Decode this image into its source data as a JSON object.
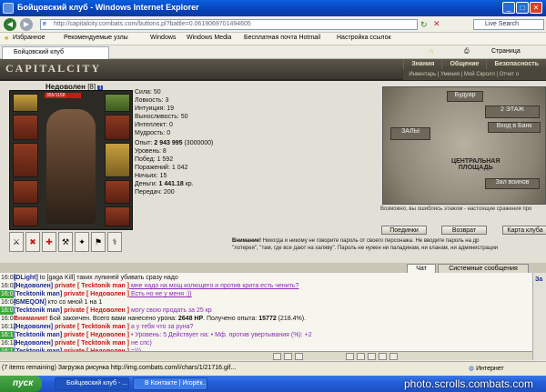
{
  "window": {
    "title": "Бойцовский клуб - Windows Internet Explorer",
    "address": "http://capitalcity.combats.com/buttons.pl?battle=0.0619069701494605",
    "search_placeholder": "Live Search"
  },
  "favorites": {
    "items": [
      "Избранное",
      "Рекомендуемые узлы",
      "Windows",
      "Windows Media",
      "Бесплатная почта Hotmail",
      "Настройка ссылок"
    ],
    "page_menu": "Страница"
  },
  "tab": {
    "label": "Бойцовский клуб"
  },
  "game": {
    "logo": "CAPITALCITY",
    "menu": [
      "Знания",
      "Общение",
      "Безопасность"
    ],
    "submenu": "Инвентарь | Умения | Мой Скролл | Отчет о",
    "character": {
      "name": "Недоволен",
      "level": "[8]",
      "badge": "i",
      "hp": "355/1158"
    },
    "stats_primary": [
      "Сила: 50",
      "Ловкость: 3",
      "Интуиция: 19",
      "Выносливость: 50",
      "Интеллект: 0",
      "Мудрость: 0"
    ],
    "stats_secondary": [
      {
        "label": "Опыт: ",
        "value": "2 943 995",
        "extra": " (3000000)"
      },
      {
        "label": "Уровень: ",
        "value": "8",
        "extra": ""
      },
      {
        "label": "Побед: ",
        "value": "1 592",
        "extra": ""
      },
      {
        "label": "Поражений: ",
        "value": "1 042",
        "extra": ""
      },
      {
        "label": "Ничьих: ",
        "value": "15",
        "extra": ""
      },
      {
        "label": "Деньги: ",
        "value": "1 441.18",
        "extra": " кр."
      },
      {
        "label": "Передач: ",
        "value": "200",
        "extra": ""
      }
    ],
    "map": {
      "buildings": [
        "Будуар",
        "2 ЭТАЖ",
        "Вход в Банк",
        "ЗАЛЫ",
        "Зал воинов"
      ],
      "center": "ЦЕНТРАЛЬНАЯ\nПЛОЩАДЬ",
      "hint": "Возможно, вы ошиблись этажом - настоящие сражения про"
    },
    "buttons": [
      "Поединки",
      "Возврат",
      "Карта клуба"
    ],
    "warning_title": "Внимание!",
    "warning_line1": " Никогда и никому не говорите пароль от своего персонажа. Не вводите пароль на др",
    "warning_line2": "\"лотерея\", \"там, где все дают на халяву\". Пароль не нужен ни паладинам, ни кланам, ни администрации"
  },
  "chat": {
    "tabs": [
      "Чат",
      "Системные сообщения"
    ],
    "rows": [
      {
        "time": "16:01",
        "hl": false,
        "parts": [
          {
            "c": "nick",
            "t": "[DLight]"
          },
          {
            "c": "sys",
            "t": " to [gaga Kill] таких лупиней убивать сразу надо "
          }
        ]
      },
      {
        "time": "16:02",
        "hl": false,
        "parts": [
          {
            "c": "nick",
            "t": "[Недоволен]"
          },
          {
            "c": "prv",
            "t": " private [ Tecktonik man ]"
          },
          {
            "c": "msg u",
            "t": " мне надо на мощ колющего и против крита есть ченить?"
          }
        ]
      },
      {
        "time": "16:03",
        "hl": true,
        "parts": [
          {
            "c": "nick",
            "t": "[Tecktonik man]"
          },
          {
            "c": "prv",
            "t": " private [ Недоволен ]"
          },
          {
            "c": "msg u",
            "t": " Есть но не у меня :))"
          }
        ]
      },
      {
        "time": "16:04",
        "hl": false,
        "parts": [
          {
            "c": "nick",
            "t": "[SMEQON]"
          },
          {
            "c": "sys",
            "t": " кто со мной 1 на 1"
          }
        ]
      },
      {
        "time": "16:05",
        "hl": true,
        "parts": [
          {
            "c": "nick",
            "t": "[Tecktonik man]"
          },
          {
            "c": "prv",
            "t": " private [ Недоволен ]"
          },
          {
            "c": "msg",
            "t": " могу свою продать за 25 кр"
          }
        ]
      },
      {
        "time": "16:07",
        "hl": false,
        "parts": [
          {
            "c": "prv",
            "t": "Внимание!"
          },
          {
            "c": "sys",
            "t": " Бой закончен. Всего вами нанесено урона: "
          },
          {
            "c": "sys bold",
            "t": "2648 HP"
          },
          {
            "c": "sys",
            "t": ". Получено опыта: "
          },
          {
            "c": "sys bold",
            "t": "15772"
          },
          {
            "c": "sys",
            "t": " (218.4%)."
          }
        ]
      },
      {
        "time": "16:12",
        "hl": false,
        "parts": [
          {
            "c": "nick",
            "t": "[Недоволен]"
          },
          {
            "c": "prv",
            "t": " private [ Tecktonik man ]"
          },
          {
            "c": "msg",
            "t": " а у тебя что за руна?"
          }
        ]
      },
      {
        "time": "16:12",
        "hl": true,
        "parts": [
          {
            "c": "nick",
            "t": "[Tecktonik man]"
          },
          {
            "c": "prv",
            "t": " private [ Недоволен ]"
          },
          {
            "c": "msg",
            "t": " • Уровень: 5 Действует на: • Мф. против увертывания (%): +2"
          }
        ]
      },
      {
        "time": "16:13",
        "hl": false,
        "parts": [
          {
            "c": "nick",
            "t": "[Недоволен]"
          },
          {
            "c": "prv",
            "t": " private [ Tecktonik man ]"
          },
          {
            "c": "msg",
            "t": " не спс)"
          }
        ]
      },
      {
        "time": "16:13",
        "hl": true,
        "parts": [
          {
            "c": "nick",
            "t": "[Tecktonik man]"
          },
          {
            "c": "prv",
            "t": " private [ Недоволен ]"
          },
          {
            "c": "msg",
            "t": " =)))"
          }
        ]
      }
    ]
  },
  "status": {
    "text": "(7 items remaining) Загрузка рисунка http://img.combats.com/i/chars/1/21716.gif...",
    "zone": "Интернет"
  },
  "taskbar": {
    "start": "пуск",
    "items": [
      "Бойцовский клуб - ...",
      "В Контакте | Игорёк..."
    ]
  },
  "watermark": "photo.scrolls.combats.com"
}
